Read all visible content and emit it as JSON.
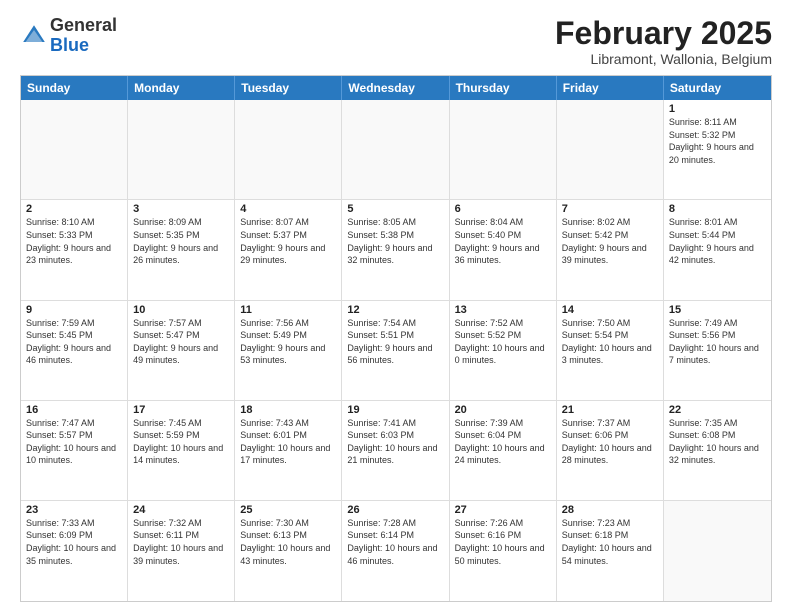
{
  "header": {
    "logo_general": "General",
    "logo_blue": "Blue",
    "month_year": "February 2025",
    "location": "Libramont, Wallonia, Belgium"
  },
  "weekdays": [
    "Sunday",
    "Monday",
    "Tuesday",
    "Wednesday",
    "Thursday",
    "Friday",
    "Saturday"
  ],
  "rows": [
    [
      {
        "day": "",
        "info": ""
      },
      {
        "day": "",
        "info": ""
      },
      {
        "day": "",
        "info": ""
      },
      {
        "day": "",
        "info": ""
      },
      {
        "day": "",
        "info": ""
      },
      {
        "day": "",
        "info": ""
      },
      {
        "day": "1",
        "info": "Sunrise: 8:11 AM\nSunset: 5:32 PM\nDaylight: 9 hours and 20 minutes."
      }
    ],
    [
      {
        "day": "2",
        "info": "Sunrise: 8:10 AM\nSunset: 5:33 PM\nDaylight: 9 hours and 23 minutes."
      },
      {
        "day": "3",
        "info": "Sunrise: 8:09 AM\nSunset: 5:35 PM\nDaylight: 9 hours and 26 minutes."
      },
      {
        "day": "4",
        "info": "Sunrise: 8:07 AM\nSunset: 5:37 PM\nDaylight: 9 hours and 29 minutes."
      },
      {
        "day": "5",
        "info": "Sunrise: 8:05 AM\nSunset: 5:38 PM\nDaylight: 9 hours and 32 minutes."
      },
      {
        "day": "6",
        "info": "Sunrise: 8:04 AM\nSunset: 5:40 PM\nDaylight: 9 hours and 36 minutes."
      },
      {
        "day": "7",
        "info": "Sunrise: 8:02 AM\nSunset: 5:42 PM\nDaylight: 9 hours and 39 minutes."
      },
      {
        "day": "8",
        "info": "Sunrise: 8:01 AM\nSunset: 5:44 PM\nDaylight: 9 hours and 42 minutes."
      }
    ],
    [
      {
        "day": "9",
        "info": "Sunrise: 7:59 AM\nSunset: 5:45 PM\nDaylight: 9 hours and 46 minutes."
      },
      {
        "day": "10",
        "info": "Sunrise: 7:57 AM\nSunset: 5:47 PM\nDaylight: 9 hours and 49 minutes."
      },
      {
        "day": "11",
        "info": "Sunrise: 7:56 AM\nSunset: 5:49 PM\nDaylight: 9 hours and 53 minutes."
      },
      {
        "day": "12",
        "info": "Sunrise: 7:54 AM\nSunset: 5:51 PM\nDaylight: 9 hours and 56 minutes."
      },
      {
        "day": "13",
        "info": "Sunrise: 7:52 AM\nSunset: 5:52 PM\nDaylight: 10 hours and 0 minutes."
      },
      {
        "day": "14",
        "info": "Sunrise: 7:50 AM\nSunset: 5:54 PM\nDaylight: 10 hours and 3 minutes."
      },
      {
        "day": "15",
        "info": "Sunrise: 7:49 AM\nSunset: 5:56 PM\nDaylight: 10 hours and 7 minutes."
      }
    ],
    [
      {
        "day": "16",
        "info": "Sunrise: 7:47 AM\nSunset: 5:57 PM\nDaylight: 10 hours and 10 minutes."
      },
      {
        "day": "17",
        "info": "Sunrise: 7:45 AM\nSunset: 5:59 PM\nDaylight: 10 hours and 14 minutes."
      },
      {
        "day": "18",
        "info": "Sunrise: 7:43 AM\nSunset: 6:01 PM\nDaylight: 10 hours and 17 minutes."
      },
      {
        "day": "19",
        "info": "Sunrise: 7:41 AM\nSunset: 6:03 PM\nDaylight: 10 hours and 21 minutes."
      },
      {
        "day": "20",
        "info": "Sunrise: 7:39 AM\nSunset: 6:04 PM\nDaylight: 10 hours and 24 minutes."
      },
      {
        "day": "21",
        "info": "Sunrise: 7:37 AM\nSunset: 6:06 PM\nDaylight: 10 hours and 28 minutes."
      },
      {
        "day": "22",
        "info": "Sunrise: 7:35 AM\nSunset: 6:08 PM\nDaylight: 10 hours and 32 minutes."
      }
    ],
    [
      {
        "day": "23",
        "info": "Sunrise: 7:33 AM\nSunset: 6:09 PM\nDaylight: 10 hours and 35 minutes."
      },
      {
        "day": "24",
        "info": "Sunrise: 7:32 AM\nSunset: 6:11 PM\nDaylight: 10 hours and 39 minutes."
      },
      {
        "day": "25",
        "info": "Sunrise: 7:30 AM\nSunset: 6:13 PM\nDaylight: 10 hours and 43 minutes."
      },
      {
        "day": "26",
        "info": "Sunrise: 7:28 AM\nSunset: 6:14 PM\nDaylight: 10 hours and 46 minutes."
      },
      {
        "day": "27",
        "info": "Sunrise: 7:26 AM\nSunset: 6:16 PM\nDaylight: 10 hours and 50 minutes."
      },
      {
        "day": "28",
        "info": "Sunrise: 7:23 AM\nSunset: 6:18 PM\nDaylight: 10 hours and 54 minutes."
      },
      {
        "day": "",
        "info": ""
      }
    ]
  ]
}
